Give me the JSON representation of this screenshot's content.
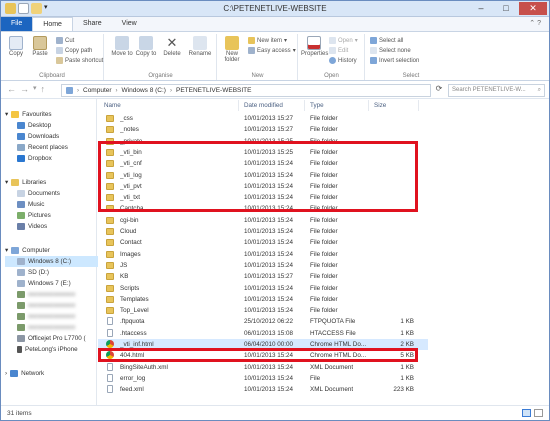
{
  "window": {
    "title": "C:\\PETENETLIVE-WEBSITE",
    "controls": [
      "–",
      "□",
      "✕"
    ]
  },
  "ribbon": {
    "tabs": [
      "File",
      "Home",
      "Share",
      "View"
    ],
    "clipboard": {
      "label": "Clipboard",
      "copy": "Copy",
      "paste": "Paste",
      "cut": "Cut",
      "copy_path": "Copy path",
      "paste_shortcut": "Paste shortcut"
    },
    "organise": {
      "label": "Organise",
      "move_to": "Move to",
      "copy_to": "Copy to",
      "delete": "Delete",
      "rename": "Rename"
    },
    "new": {
      "label": "New",
      "new_folder": "New folder",
      "new_item": "New item",
      "easy_access": "Easy access"
    },
    "open": {
      "label": "Open",
      "properties": "Properties",
      "open": "Open",
      "edit": "Edit",
      "history": "History"
    },
    "select": {
      "label": "Select",
      "select_all": "Select all",
      "select_none": "Select none",
      "invert_selection": "Invert selection"
    }
  },
  "address": {
    "crumbs": [
      "Computer",
      "Windows 8 (C:)",
      "PETENETLIVE-WEBSITE"
    ],
    "search_placeholder": "Search PETENETLIVE-W..."
  },
  "nav": {
    "favourites": "Favourites",
    "desktop": "Desktop",
    "downloads": "Downloads",
    "recent": "Recent places",
    "dropbox": "Dropbox",
    "libraries": "Libraries",
    "documents": "Documents",
    "music": "Music",
    "pictures": "Pictures",
    "videos": "Videos",
    "computer": "Computer",
    "win8": "Windows 8 (C:)",
    "sd": "SD (D:)",
    "win7": "Windows 7 (E:)",
    "blurred1": "xxxxxxxxxxxxxxx",
    "blurred2": "xxxxxxxxxxxxxxx",
    "blurred3": "xxxxxxxxxxxxxxx",
    "blurred4": "xxxxxxxxxxxxxxx",
    "officejet": "Officejet Pro L7700 (",
    "iphone": "PeteLong's iPhone",
    "network": "Network"
  },
  "columns": {
    "name": "Name",
    "date": "Date modified",
    "type": "Type",
    "size": "Size"
  },
  "files": [
    {
      "name": "_css",
      "date": "10/01/2013 15:27",
      "type": "File folder",
      "size": "",
      "icon": "folder"
    },
    {
      "name": "_notes",
      "date": "10/01/2013 15:27",
      "type": "File folder",
      "size": "",
      "icon": "folder"
    },
    {
      "name": "_private",
      "date": "10/01/2013 15:25",
      "type": "File folder",
      "size": "",
      "icon": "folder"
    },
    {
      "name": "_vti_bin",
      "date": "10/01/2013 15:25",
      "type": "File folder",
      "size": "",
      "icon": "folder"
    },
    {
      "name": "_vti_cnf",
      "date": "10/01/2013 15:24",
      "type": "File folder",
      "size": "",
      "icon": "folder"
    },
    {
      "name": "_vti_log",
      "date": "10/01/2013 15:24",
      "type": "File folder",
      "size": "",
      "icon": "folder"
    },
    {
      "name": "_vti_pvt",
      "date": "10/01/2013 15:24",
      "type": "File folder",
      "size": "",
      "icon": "folder"
    },
    {
      "name": "_vti_txt",
      "date": "10/01/2013 15:24",
      "type": "File folder",
      "size": "",
      "icon": "folder"
    },
    {
      "name": "Captcha",
      "date": "10/01/2013 15:24",
      "type": "File folder",
      "size": "",
      "icon": "folder"
    },
    {
      "name": "cgi-bin",
      "date": "10/01/2013 15:24",
      "type": "File folder",
      "size": "",
      "icon": "folder"
    },
    {
      "name": "Cloud",
      "date": "10/01/2013 15:24",
      "type": "File folder",
      "size": "",
      "icon": "folder"
    },
    {
      "name": "Contact",
      "date": "10/01/2013 15:24",
      "type": "File folder",
      "size": "",
      "icon": "folder"
    },
    {
      "name": "Images",
      "date": "10/01/2013 15:24",
      "type": "File folder",
      "size": "",
      "icon": "folder"
    },
    {
      "name": "JS",
      "date": "10/01/2013 15:24",
      "type": "File folder",
      "size": "",
      "icon": "folder"
    },
    {
      "name": "KB",
      "date": "10/01/2013 15:27",
      "type": "File folder",
      "size": "",
      "icon": "folder"
    },
    {
      "name": "Scripts",
      "date": "10/01/2013 15:24",
      "type": "File folder",
      "size": "",
      "icon": "folder"
    },
    {
      "name": "Templates",
      "date": "10/01/2013 15:24",
      "type": "File folder",
      "size": "",
      "icon": "folder"
    },
    {
      "name": "Top_Level",
      "date": "10/01/2013 15:24",
      "type": "File folder",
      "size": "",
      "icon": "folder"
    },
    {
      "name": ".ftpquota",
      "date": "25/10/2012 06:22",
      "type": "FTPQUOTA File",
      "size": "1 KB",
      "icon": "file"
    },
    {
      "name": ".htaccess",
      "date": "06/01/2013 15:08",
      "type": "HTACCESS File",
      "size": "1 KB",
      "icon": "file"
    },
    {
      "name": "_vti_inf.html",
      "date": "06/04/2010 00:00",
      "type": "Chrome HTML Do...",
      "size": "2 KB",
      "icon": "chrome"
    },
    {
      "name": "404.html",
      "date": "10/01/2013 15:24",
      "type": "Chrome HTML Do...",
      "size": "5 KB",
      "icon": "chrome"
    },
    {
      "name": "BingSiteAuth.xml",
      "date": "10/01/2013 15:24",
      "type": "XML Document",
      "size": "1 KB",
      "icon": "file"
    },
    {
      "name": "error_log",
      "date": "10/01/2013 15:24",
      "type": "File",
      "size": "1 KB",
      "icon": "file"
    },
    {
      "name": "feed.xml",
      "date": "10/01/2013 15:24",
      "type": "XML Document",
      "size": "223 KB",
      "icon": "file"
    }
  ],
  "status": {
    "count": "31 items"
  },
  "colors": {
    "accent": "#1c65c0",
    "highlight_box": "#e0121f",
    "folder": "#e8c45a"
  }
}
